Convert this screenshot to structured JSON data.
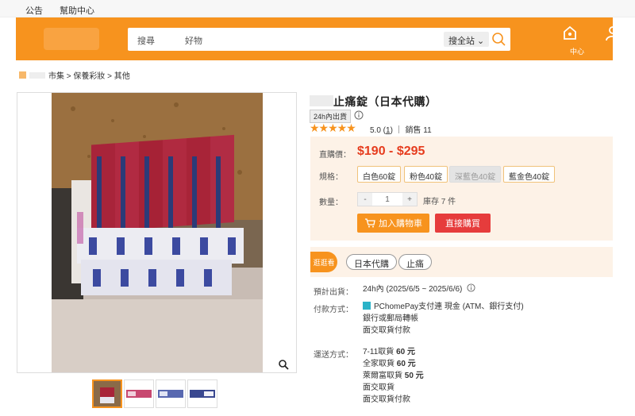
{
  "topbar": {
    "announcements": "公告",
    "help": "幫助中心"
  },
  "header": {
    "search_prefix": "搜尋",
    "search_suffix": "好物",
    "search_scope": "搜全站",
    "icons": [
      "search-icon",
      "shop-icon",
      "user-icon"
    ],
    "right_label": "中心",
    "accent": "#f7931e"
  },
  "breadcrumb": "市集 > 保養彩妝 > 其他",
  "product": {
    "title": "止痛錠（日本代購）",
    "ship_badge": "24h內出貨",
    "stars": "★★★★★",
    "rating": "5.0",
    "reviews": "1",
    "sales_label": "銷售",
    "sales": "11",
    "price_label": "直購價：",
    "price": "$190 - $295",
    "spec_label": "規格：",
    "specs": [
      "白色60錠",
      "粉色40錠",
      "深藍色40錠",
      "藍金色40錠"
    ],
    "qty_label": "數量：",
    "qty_minus": "-",
    "qty_value": "1",
    "qty_plus": "+",
    "stock": "庫存 7 件",
    "add_cart": "加入購物車",
    "buy_now": "直接購買",
    "price_color": "#e63c1e"
  },
  "tags": {
    "label": "逛逛看",
    "items": [
      "日本代購",
      "止痛"
    ]
  },
  "details": {
    "ship_label": "預計出貨：",
    "ship_value": "24h內 (2025/6/5 ~ 2025/6/6)",
    "pay_label": "付款方式：",
    "pay_lines": [
      "PChomePay支付連 現金 (ATM、銀行支付)",
      "銀行或郵局轉帳",
      "面交取貨付款"
    ],
    "delivery_label": "運送方式：",
    "delivery_lines": [
      {
        "name": "7-11取貨",
        "price": "60 元"
      },
      {
        "name": "全家取貨",
        "price": "60 元"
      },
      {
        "name": "萊爾富取貨",
        "price": "50 元"
      },
      {
        "name": "面交取貨",
        "price": ""
      },
      {
        "name": "面交取貨付款",
        "price": ""
      }
    ]
  }
}
